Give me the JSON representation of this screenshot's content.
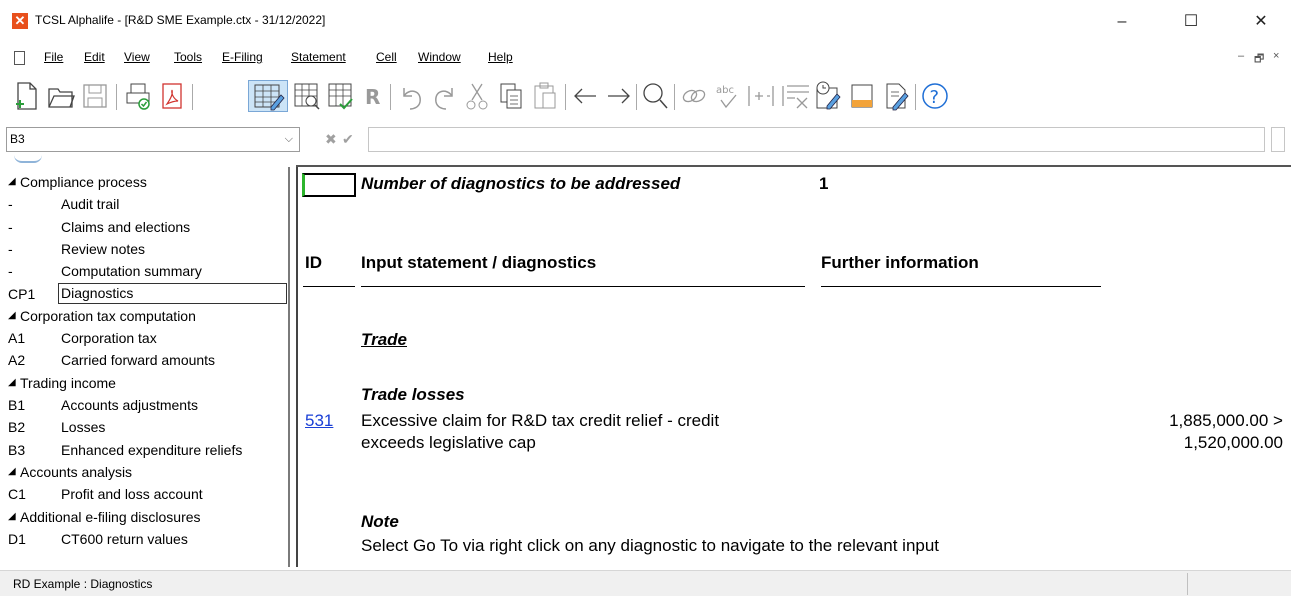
{
  "window": {
    "title": "TCSL Alphalife - [R&D SME Example.ctx - 31/12/2022]",
    "minimize": "–",
    "maximize": "☐",
    "close": "✕"
  },
  "menu": {
    "items": [
      "File",
      "Edit",
      "View",
      "Tools",
      "E-Filing",
      "Statement",
      "Cell",
      "Window",
      "Help"
    ],
    "mdi_min": "–",
    "mdi_restore": "🗗",
    "mdi_close": "×"
  },
  "formula_bar": {
    "cell_ref": "B3",
    "cancel": "✖",
    "confirm": "✔",
    "value": ""
  },
  "tree": {
    "items": [
      {
        "ref": "◢",
        "label": "Compliance process",
        "group": true
      },
      {
        "ref": "-",
        "label": "Audit trail"
      },
      {
        "ref": "-",
        "label": "Claims and elections"
      },
      {
        "ref": "-",
        "label": "Review notes"
      },
      {
        "ref": "-",
        "label": "Computation summary"
      },
      {
        "ref": "CP1",
        "label": "Diagnostics",
        "selected": true
      },
      {
        "ref": "◢",
        "label": "Corporation tax computation",
        "group": true
      },
      {
        "ref": "A1",
        "label": "Corporation tax"
      },
      {
        "ref": "A2",
        "label": "Carried forward amounts"
      },
      {
        "ref": "◢",
        "label": "Trading income",
        "group": true
      },
      {
        "ref": "B1",
        "label": "Accounts adjustments"
      },
      {
        "ref": "B2",
        "label": "Losses"
      },
      {
        "ref": "B3",
        "label": "Enhanced expenditure reliefs"
      },
      {
        "ref": "◢",
        "label": "Accounts analysis",
        "group": true
      },
      {
        "ref": "C1",
        "label": "Profit and loss account"
      },
      {
        "ref": "◢",
        "label": "Additional e-filing disclosures",
        "group": true
      },
      {
        "ref": "D1",
        "label": "CT600 return values"
      }
    ]
  },
  "main": {
    "count_label": "Number of diagnostics to be addressed",
    "count_value": "1",
    "col_id": "ID",
    "col_statement": "Input statement / diagnostics",
    "col_further": "Further information",
    "section": "Trade",
    "subsection": "Trade losses",
    "diag_id": "531",
    "diag_line1": "Excessive claim for R&D tax credit relief - credit",
    "diag_line2": "exceeds legislative cap",
    "diag_value1": "1,885,000.00 >",
    "diag_value2": "1,520,000.00",
    "note_title": "Note",
    "note_text": "Select Go To via right click on any diagnostic to navigate to the relevant input"
  },
  "status": {
    "text": "RD Example : Diagnostics"
  },
  "colors": {
    "app_icon": "#e8501c",
    "link": "#1a3fd6",
    "cursor_marker": "#2db52d"
  }
}
